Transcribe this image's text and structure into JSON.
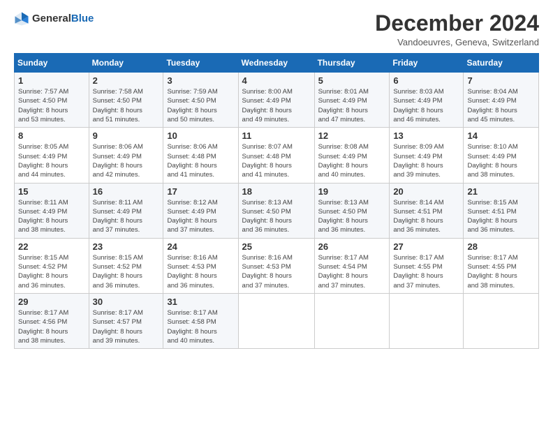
{
  "header": {
    "logo_general": "General",
    "logo_blue": "Blue",
    "title": "December 2024",
    "subtitle": "Vandoeuvres, Geneva, Switzerland"
  },
  "calendar": {
    "days_of_week": [
      "Sunday",
      "Monday",
      "Tuesday",
      "Wednesday",
      "Thursday",
      "Friday",
      "Saturday"
    ],
    "weeks": [
      [
        {
          "day": "1",
          "detail": "Sunrise: 7:57 AM\nSunset: 4:50 PM\nDaylight: 8 hours\nand 53 minutes."
        },
        {
          "day": "2",
          "detail": "Sunrise: 7:58 AM\nSunset: 4:50 PM\nDaylight: 8 hours\nand 51 minutes."
        },
        {
          "day": "3",
          "detail": "Sunrise: 7:59 AM\nSunset: 4:50 PM\nDaylight: 8 hours\nand 50 minutes."
        },
        {
          "day": "4",
          "detail": "Sunrise: 8:00 AM\nSunset: 4:49 PM\nDaylight: 8 hours\nand 49 minutes."
        },
        {
          "day": "5",
          "detail": "Sunrise: 8:01 AM\nSunset: 4:49 PM\nDaylight: 8 hours\nand 47 minutes."
        },
        {
          "day": "6",
          "detail": "Sunrise: 8:03 AM\nSunset: 4:49 PM\nDaylight: 8 hours\nand 46 minutes."
        },
        {
          "day": "7",
          "detail": "Sunrise: 8:04 AM\nSunset: 4:49 PM\nDaylight: 8 hours\nand 45 minutes."
        }
      ],
      [
        {
          "day": "8",
          "detail": "Sunrise: 8:05 AM\nSunset: 4:49 PM\nDaylight: 8 hours\nand 44 minutes."
        },
        {
          "day": "9",
          "detail": "Sunrise: 8:06 AM\nSunset: 4:49 PM\nDaylight: 8 hours\nand 42 minutes."
        },
        {
          "day": "10",
          "detail": "Sunrise: 8:06 AM\nSunset: 4:48 PM\nDaylight: 8 hours\nand 41 minutes."
        },
        {
          "day": "11",
          "detail": "Sunrise: 8:07 AM\nSunset: 4:48 PM\nDaylight: 8 hours\nand 41 minutes."
        },
        {
          "day": "12",
          "detail": "Sunrise: 8:08 AM\nSunset: 4:49 PM\nDaylight: 8 hours\nand 40 minutes."
        },
        {
          "day": "13",
          "detail": "Sunrise: 8:09 AM\nSunset: 4:49 PM\nDaylight: 8 hours\nand 39 minutes."
        },
        {
          "day": "14",
          "detail": "Sunrise: 8:10 AM\nSunset: 4:49 PM\nDaylight: 8 hours\nand 38 minutes."
        }
      ],
      [
        {
          "day": "15",
          "detail": "Sunrise: 8:11 AM\nSunset: 4:49 PM\nDaylight: 8 hours\nand 38 minutes."
        },
        {
          "day": "16",
          "detail": "Sunrise: 8:11 AM\nSunset: 4:49 PM\nDaylight: 8 hours\nand 37 minutes."
        },
        {
          "day": "17",
          "detail": "Sunrise: 8:12 AM\nSunset: 4:49 PM\nDaylight: 8 hours\nand 37 minutes."
        },
        {
          "day": "18",
          "detail": "Sunrise: 8:13 AM\nSunset: 4:50 PM\nDaylight: 8 hours\nand 36 minutes."
        },
        {
          "day": "19",
          "detail": "Sunrise: 8:13 AM\nSunset: 4:50 PM\nDaylight: 8 hours\nand 36 minutes."
        },
        {
          "day": "20",
          "detail": "Sunrise: 8:14 AM\nSunset: 4:51 PM\nDaylight: 8 hours\nand 36 minutes."
        },
        {
          "day": "21",
          "detail": "Sunrise: 8:15 AM\nSunset: 4:51 PM\nDaylight: 8 hours\nand 36 minutes."
        }
      ],
      [
        {
          "day": "22",
          "detail": "Sunrise: 8:15 AM\nSunset: 4:52 PM\nDaylight: 8 hours\nand 36 minutes."
        },
        {
          "day": "23",
          "detail": "Sunrise: 8:15 AM\nSunset: 4:52 PM\nDaylight: 8 hours\nand 36 minutes."
        },
        {
          "day": "24",
          "detail": "Sunrise: 8:16 AM\nSunset: 4:53 PM\nDaylight: 8 hours\nand 36 minutes."
        },
        {
          "day": "25",
          "detail": "Sunrise: 8:16 AM\nSunset: 4:53 PM\nDaylight: 8 hours\nand 37 minutes."
        },
        {
          "day": "26",
          "detail": "Sunrise: 8:17 AM\nSunset: 4:54 PM\nDaylight: 8 hours\nand 37 minutes."
        },
        {
          "day": "27",
          "detail": "Sunrise: 8:17 AM\nSunset: 4:55 PM\nDaylight: 8 hours\nand 37 minutes."
        },
        {
          "day": "28",
          "detail": "Sunrise: 8:17 AM\nSunset: 4:55 PM\nDaylight: 8 hours\nand 38 minutes."
        }
      ],
      [
        {
          "day": "29",
          "detail": "Sunrise: 8:17 AM\nSunset: 4:56 PM\nDaylight: 8 hours\nand 38 minutes."
        },
        {
          "day": "30",
          "detail": "Sunrise: 8:17 AM\nSunset: 4:57 PM\nDaylight: 8 hours\nand 39 minutes."
        },
        {
          "day": "31",
          "detail": "Sunrise: 8:17 AM\nSunset: 4:58 PM\nDaylight: 8 hours\nand 40 minutes."
        },
        {
          "day": "",
          "detail": ""
        },
        {
          "day": "",
          "detail": ""
        },
        {
          "day": "",
          "detail": ""
        },
        {
          "day": "",
          "detail": ""
        }
      ]
    ]
  }
}
